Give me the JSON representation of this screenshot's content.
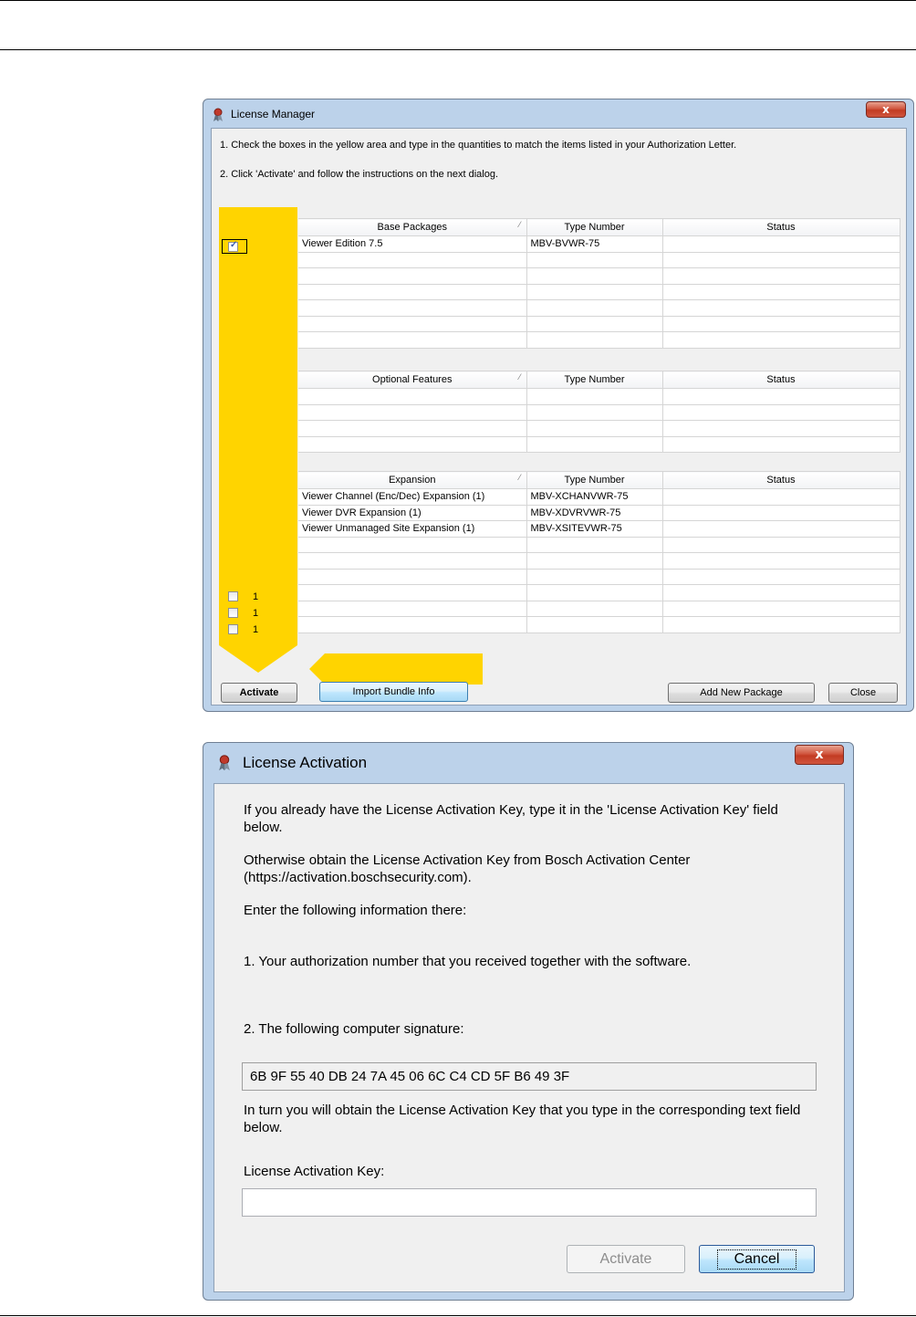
{
  "license_manager": {
    "title": "License Manager",
    "instruction_1": "1. Check the boxes in the yellow area and type in the quantities to match the items listed in your Authorization Letter.",
    "instruction_2": "2. Click 'Activate' and follow the instructions on the next dialog.",
    "base_packages": {
      "headers": [
        "Base Packages",
        "Type Number",
        "Status"
      ],
      "rows": [
        {
          "name": "Viewer Edition 7.5",
          "type": "MBV-BVWR-75",
          "status": "",
          "checked": true
        }
      ]
    },
    "optional_features": {
      "headers": [
        "Optional Features",
        "Type Number",
        "Status"
      ],
      "rows": []
    },
    "expansion": {
      "headers": [
        "Expansion",
        "Type Number",
        "Status"
      ],
      "rows": [
        {
          "qty": "1",
          "name": "Viewer Channel (Enc/Dec) Expansion (1)",
          "type": "MBV-XCHANVWR-75",
          "status": "",
          "checked": false
        },
        {
          "qty": "1",
          "name": "Viewer DVR Expansion (1)",
          "type": "MBV-XDVRVWR-75",
          "status": "",
          "checked": false
        },
        {
          "qty": "1",
          "name": "Viewer Unmanaged Site Expansion (1)",
          "type": "MBV-XSITEVWR-75",
          "status": "",
          "checked": false
        }
      ]
    },
    "buttons": {
      "activate": "Activate",
      "import_bundle": "Import Bundle Info",
      "add_new_package": "Add New Package",
      "close": "Close"
    },
    "highlight_color": "#ffd400"
  },
  "license_activation": {
    "title": "License Activation",
    "para_1": "If you already have the License Activation Key, type it in the 'License Activation Key' field below.",
    "para_2": "Otherwise obtain the License Activation Key from Bosch Activation Center (https://activation.boschsecurity.com).",
    "para_3": "Enter the following information there:",
    "step_1": "1. Your authorization number that you received together with the software.",
    "step_2": "2. The following computer signature:",
    "signature": "6B 9F 55 40 DB 24 7A 45 06 6C C4 CD 5F B6 49 3F",
    "para_4": "In turn you will obtain the License Activation Key that you type in the corresponding text field below.",
    "key_label": "License Activation Key:",
    "key_value": "",
    "buttons": {
      "activate": "Activate",
      "cancel": "Cancel"
    }
  },
  "icons": {
    "close": "x",
    "checkmark": "✓",
    "sort": "⁄"
  }
}
